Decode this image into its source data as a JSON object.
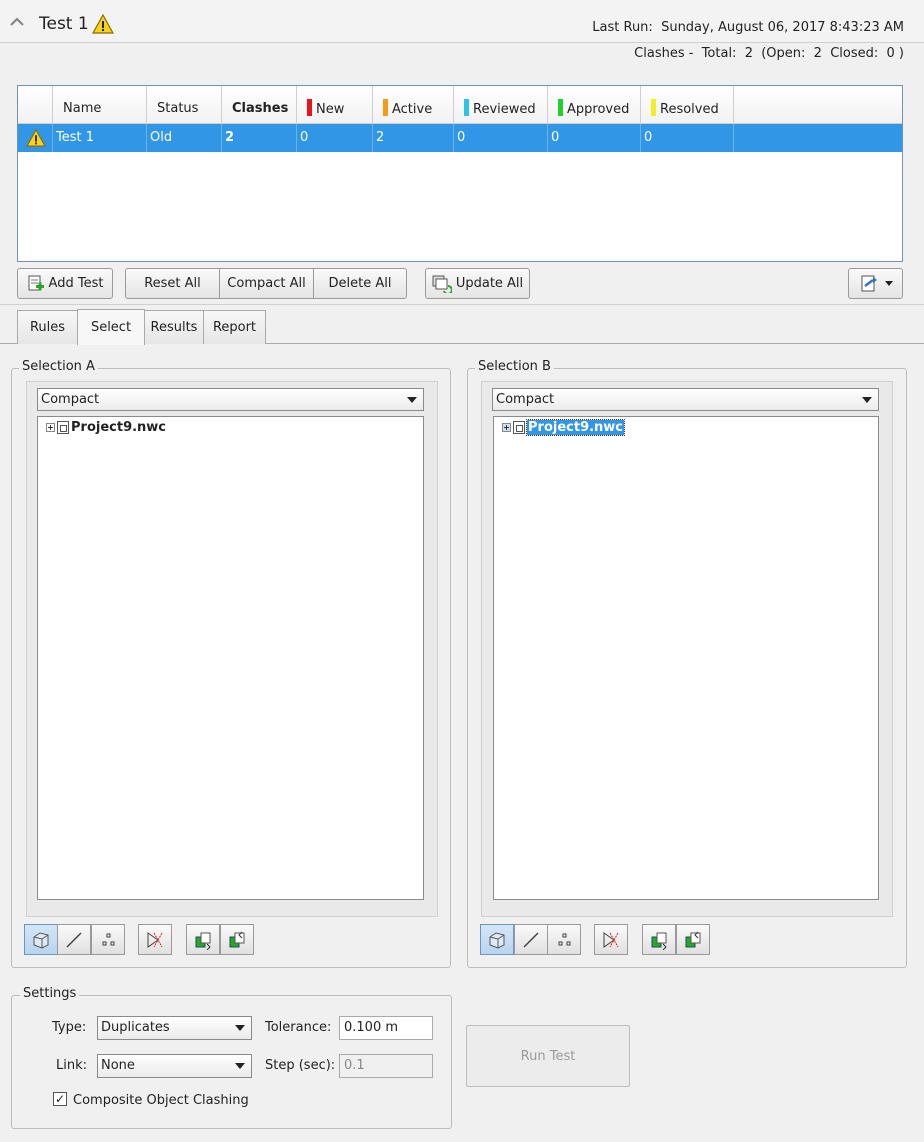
{
  "header": {
    "title": "Test 1",
    "last_run_label": "Last Run:",
    "last_run_value": "Sunday, August 06, 2017 8:43:23 AM",
    "clash_summary": "Clashes -  Total:  2  (Open:  2  Closed:  0 )"
  },
  "grid": {
    "columns": [
      "Name",
      "Status",
      "Clashes",
      "New",
      "Active",
      "Reviewed",
      "Approved",
      "Resolved"
    ],
    "row": {
      "name": "Test 1",
      "status": "Old",
      "clashes": "2",
      "new": "0",
      "active": "2",
      "reviewed": "0",
      "approved": "0",
      "resolved": "0"
    },
    "colors": {
      "new": "#e8141c",
      "active": "#f39c1a",
      "reviewed": "#2bc3ec",
      "approved": "#1fd12a",
      "resolved": "#f5ee22"
    }
  },
  "toolbar": {
    "add_test": "Add Test",
    "reset_all": "Reset All",
    "compact_all": "Compact All",
    "delete_all": "Delete All",
    "update_all": "Update All"
  },
  "tabs": [
    "Rules",
    "Select",
    "Results",
    "Report"
  ],
  "selection_a": {
    "label": "Selection A",
    "mode": "Compact",
    "node": "Project9.nwc"
  },
  "selection_b": {
    "label": "Selection B",
    "mode": "Compact",
    "node": "Project9.nwc"
  },
  "settings": {
    "label": "Settings",
    "type_label": "Type:",
    "type_value": "Duplicates",
    "tolerance_label": "Tolerance:",
    "tolerance_value": "0.100 m",
    "link_label": "Link:",
    "link_value": "None",
    "step_label": "Step (sec):",
    "step_value": "0.1",
    "composite_label": "Composite Object Clashing",
    "composite_checked": true
  },
  "run_test": "Run Test",
  "icons": [
    "chevron-up-icon",
    "warning-icon",
    "add-test-icon",
    "update-icon",
    "export-icon",
    "surfaces-icon",
    "lines-icon",
    "points-icon",
    "self-intersect-icon",
    "use-current-selection-icon",
    "select-in-scene-icon"
  ]
}
